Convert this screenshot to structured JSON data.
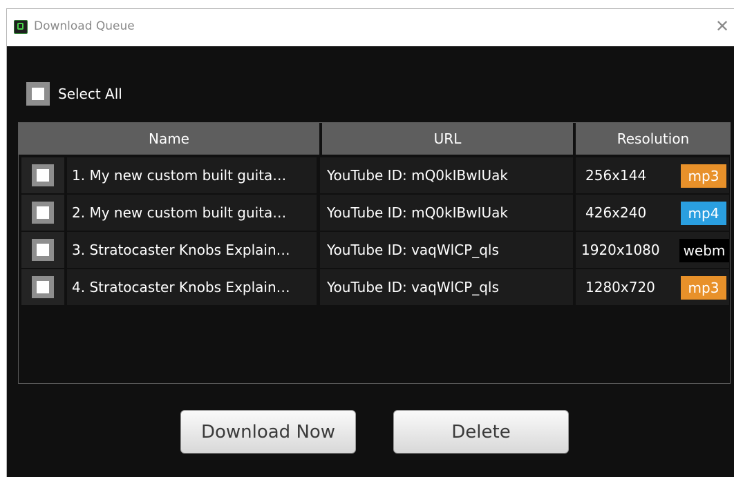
{
  "window": {
    "title": "Download Queue",
    "close_glyph": "✕"
  },
  "select_all": {
    "label": "Select All",
    "checked": false
  },
  "table": {
    "columns": [
      "Name",
      "URL",
      "Resolution"
    ],
    "rows": [
      {
        "name": "1. My new custom built guita…",
        "url": "YouTube ID: mQ0kIBwIUak",
        "resolution": "256x144",
        "format": "mp3",
        "format_color": "#e8912a",
        "checked": false
      },
      {
        "name": "2. My new custom built guita…",
        "url": "YouTube ID: mQ0kIBwIUak",
        "resolution": "426x240",
        "format": "mp4",
        "format_color": "#2a9fe0",
        "checked": false
      },
      {
        "name": "3. Stratocaster Knobs Explain…",
        "url": "YouTube ID: vaqWlCP_qls",
        "resolution": "1920x1080",
        "format": "webm",
        "format_color": "#000000",
        "checked": false
      },
      {
        "name": "4. Stratocaster Knobs Explain…",
        "url": "YouTube ID: vaqWlCP_qls",
        "resolution": "1280x720",
        "format": "mp3",
        "format_color": "#e8912a",
        "checked": false
      }
    ]
  },
  "buttons": {
    "download": "Download Now",
    "delete": "Delete"
  },
  "icons": {
    "app": "app-logo-icon",
    "close": "close-icon",
    "checkbox": "checkbox-icon"
  }
}
